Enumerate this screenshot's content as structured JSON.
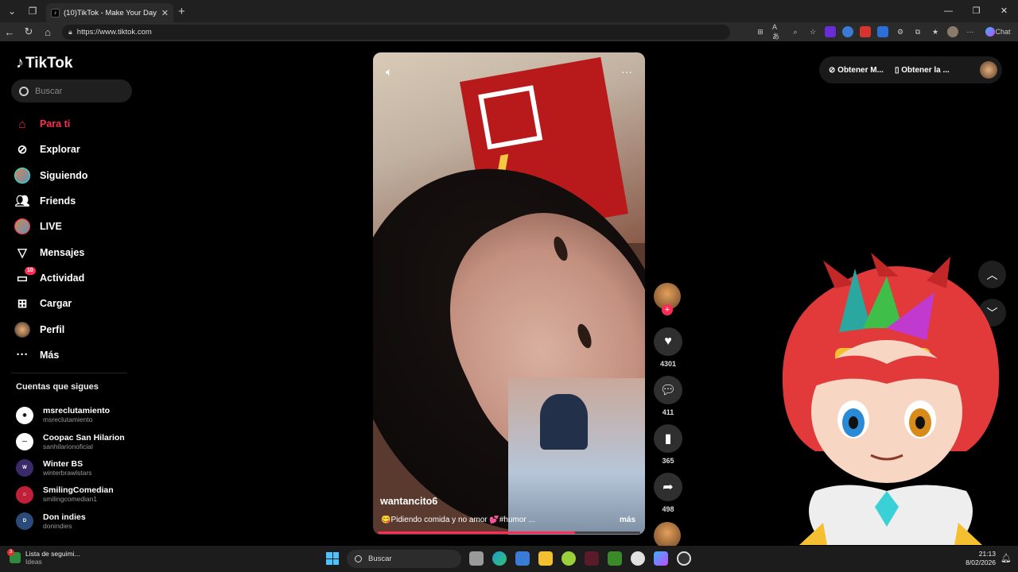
{
  "browser": {
    "tab_title": "(10)TikTok - Make Your Day",
    "url": "https://www.tiktok.com",
    "chat_label": "Chat",
    "window_min": "—",
    "window_max": "❐",
    "window_close": "✕"
  },
  "sidebar": {
    "logo": "TikTok",
    "search_placeholder": "Buscar",
    "menu": [
      {
        "label": "Para ti",
        "icon": "home-icon"
      },
      {
        "label": "Explorar",
        "icon": "compass-icon"
      },
      {
        "label": "Siguiendo",
        "icon": "following-avatar"
      },
      {
        "label": "Friends",
        "icon": "friends-icon"
      },
      {
        "label": "LIVE",
        "icon": "live-avatar"
      },
      {
        "label": "Mensajes",
        "icon": "send-icon"
      },
      {
        "label": "Actividad",
        "icon": "activity-icon",
        "badge": "10"
      },
      {
        "label": "Cargar",
        "icon": "upload-icon"
      },
      {
        "label": "Perfil",
        "icon": "profile-avatar"
      },
      {
        "label": "Más",
        "icon": "more-icon"
      }
    ],
    "following_title": "Cuentas que sigues",
    "following": [
      {
        "name": "msreclutamiento",
        "handle": "msreclutamiento"
      },
      {
        "name": "Coopac San Hilarion",
        "handle": "sanhilarionoficial"
      },
      {
        "name": "Winter BS",
        "handle": "winterbrawlstars"
      },
      {
        "name": "SmilingComedian",
        "handle": "smilingcomedian1"
      },
      {
        "name": "Don indies",
        "handle": "donindies"
      }
    ]
  },
  "video": {
    "username": "wantancito6",
    "caption": "😋Pidiendo comida y no amor 💕#humor ...",
    "more_label": "más",
    "progress": 0.75
  },
  "actions": {
    "likes": "4301",
    "comments": "411",
    "saves": "365",
    "shares": "498"
  },
  "topright": {
    "btn1": "Obtener M...",
    "btn2": "Obtener la ..."
  },
  "taskbar": {
    "widget_title": "Lista de seguimi...",
    "widget_sub": "Ideas",
    "widget_badge": "3",
    "search": "Buscar",
    "time": "21:13",
    "date": "8/02/2026"
  },
  "colors": {
    "accent": "#fe2c55",
    "background": "#000000"
  }
}
